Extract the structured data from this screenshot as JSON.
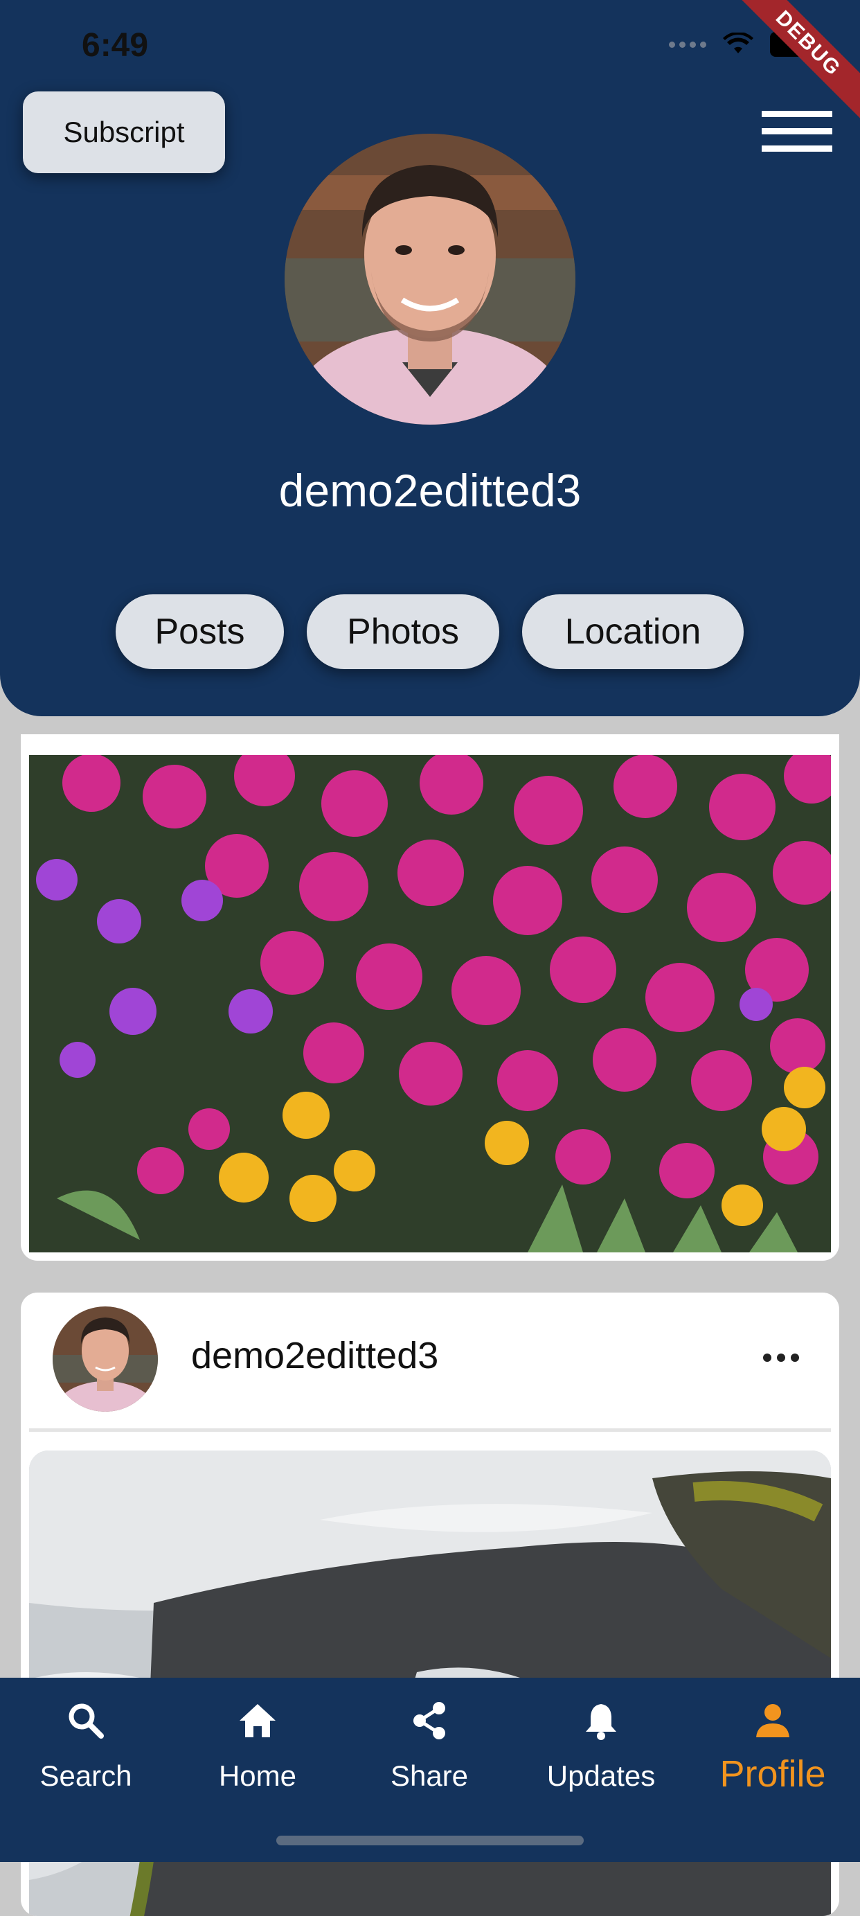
{
  "status_bar": {
    "time": "6:49"
  },
  "debug_banner": "DEBUG",
  "header": {
    "subscript_label": "Subscript",
    "username": "demo2editted3",
    "pills": [
      "Posts",
      "Photos",
      "Location"
    ]
  },
  "post": {
    "username": "demo2editted3"
  },
  "bottom_nav": {
    "items": [
      {
        "label": "Search",
        "icon": "search-icon"
      },
      {
        "label": "Home",
        "icon": "home-icon"
      },
      {
        "label": "Share",
        "icon": "share-icon"
      },
      {
        "label": "Updates",
        "icon": "bell-icon"
      },
      {
        "label": "Profile",
        "icon": "person-icon"
      }
    ],
    "active": "Profile"
  },
  "colors": {
    "header_bg": "#14335c",
    "active_accent": "#f2941e",
    "background": "#c9c9c9"
  }
}
